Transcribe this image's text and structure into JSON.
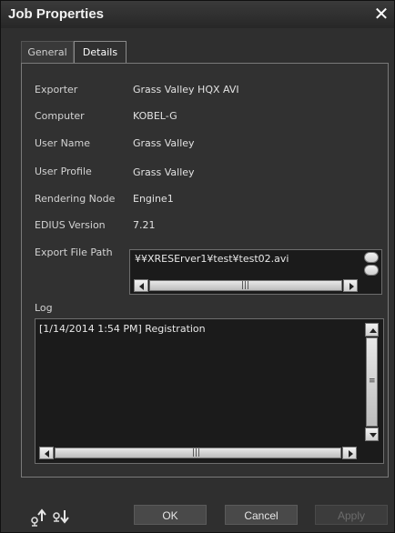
{
  "window": {
    "title": "Job Properties",
    "close_glyph": "✕"
  },
  "tabs": [
    {
      "label": "General"
    },
    {
      "label": "Details"
    }
  ],
  "details": {
    "fields": [
      {
        "label": "Exporter",
        "value": "Grass Valley HQX AVI"
      },
      {
        "label": "Computer",
        "value": "KOBEL-G"
      },
      {
        "label": "User Name",
        "value": "Grass Valley"
      },
      {
        "label": "User Profile",
        "value": "Grass Valley"
      },
      {
        "label": "Rendering Node",
        "value": "Engine1"
      },
      {
        "label": "EDIUS Version",
        "value": "7.21"
      }
    ],
    "export_path": {
      "label": "Export File Path",
      "value": "¥¥XRESErver1¥test¥test02.avi"
    },
    "log": {
      "label": "Log",
      "entry": "[1/14/2014 1:54 PM]  Registration"
    }
  },
  "footer": {
    "buttons": {
      "ok": "OK",
      "cancel": "Cancel",
      "apply": "Apply"
    },
    "icons": [
      "export-up-icon",
      "import-down-icon"
    ]
  },
  "colors": {
    "background": "#2f2f2f",
    "panel_border": "#7a7a7a",
    "text": "#d6d6d6"
  }
}
